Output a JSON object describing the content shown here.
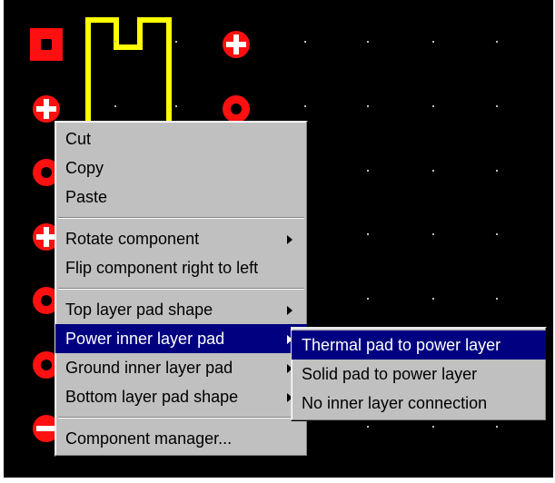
{
  "context_menu": {
    "items": [
      {
        "label": "Cut"
      },
      {
        "label": "Copy"
      },
      {
        "label": "Paste"
      },
      {
        "label": "Rotate component",
        "has_submenu": true
      },
      {
        "label": "Flip component right to left"
      },
      {
        "label": "Top layer pad shape",
        "has_submenu": true
      },
      {
        "label": "Power inner layer pad",
        "has_submenu": true,
        "selected": true
      },
      {
        "label": "Ground inner layer pad",
        "has_submenu": true
      },
      {
        "label": "Bottom layer pad shape",
        "has_submenu": true
      },
      {
        "label": "Component manager..."
      }
    ]
  },
  "submenu": {
    "items": [
      {
        "label": "Thermal pad to power layer",
        "selected": true
      },
      {
        "label": "Solid pad to power layer"
      },
      {
        "label": "No inner layer connection"
      }
    ]
  },
  "colors": {
    "canvas_background": "#000000",
    "pad": "#ff1010",
    "component_outline": "#ffff00",
    "grid_dot": "#bdbdbd",
    "menu_background": "#c0c0c0",
    "selection": "#000080"
  },
  "icons": {
    "square_pad": "square-pad-icon",
    "round_pad": "round-pad-icon",
    "thermal_pad": "thermal-pad-icon",
    "submenu_arrow": "arrow-right-icon"
  }
}
